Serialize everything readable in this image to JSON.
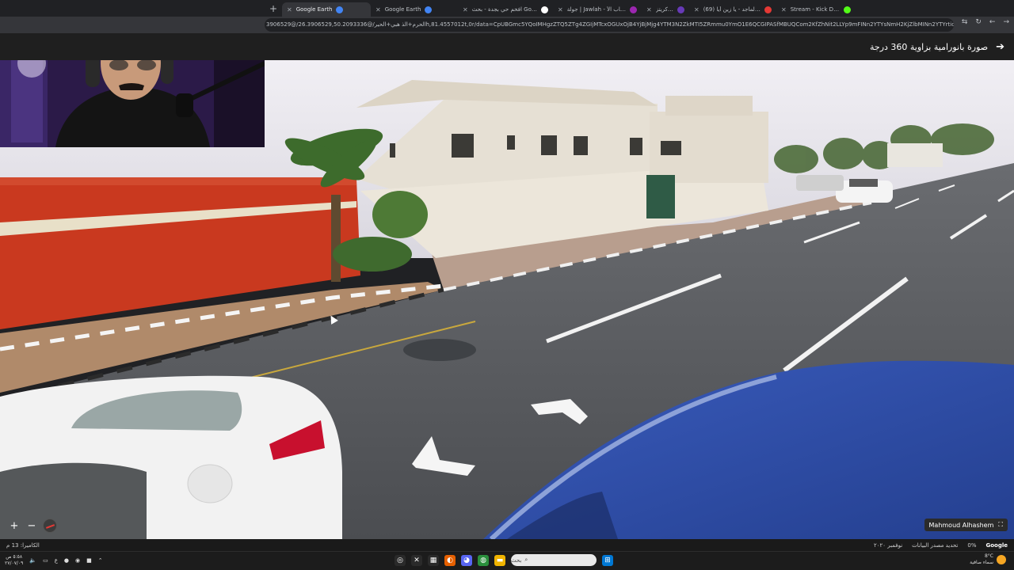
{
  "browser": {
    "tabs": [
      {
        "label": "Google Earth",
        "active": true,
        "fav_color": "#4285f4"
      },
      {
        "label": "Google Earth",
        "active": false,
        "fav_color": "#4285f4"
      },
      {
        "label": "افخم حي بجدة - بحث Google",
        "active": false,
        "fav_color": "#ffffff"
      },
      {
        "label": "جولة | Jawlah - منصة الألعاب الأ...",
        "active": false,
        "fav_color": "#9c27b0"
      },
      {
        "label": "المحفظة | كريتز",
        "active": false,
        "fav_color": "#673ab7"
      },
      {
        "label": "(69) راشد الماجد - يا زين أيا...",
        "active": false,
        "fav_color": "#e53935"
      },
      {
        "label": "Stream - Kick Dashboard",
        "active": false,
        "fav_color": "#53fc18"
      }
    ],
    "new_tab": "+",
    "url": "3906529@/الحرم+الذ هبي+الحير/@26.3906529,50.2093336h,81.4557012t,0r/data=CpUBGmc5YQoIMHgzZTQ5ZTg4ZGIjMTcxOGUxOjB4YjBjMjg4YTM3N2ZkMTI5ZRmmu0YmO1E6QCGIPASfMBUQCom2KfZhNit2LLYp9mFINn2YTYsNmH2KjZlbMINn2YTYrtio2LEYASABIiYKJAmYWDwGNMU...",
    "nav": [
      "⇆",
      "↻",
      "←",
      "→"
    ]
  },
  "streetview": {
    "title": "صورة بانورامية بزاوية 360 درجة",
    "back_icon": "arrow-right-icon"
  },
  "controls": {
    "zoom_in": "+",
    "zoom_out": "−",
    "attribution": "Mahmoud Alhashem"
  },
  "status": {
    "left": "الكاميرا: 13 م",
    "right_items": [
      "نوفمبر ٢٠٢٠",
      "تحديد مصدر البيانات",
      "0%"
    ],
    "brand": "Google"
  },
  "taskbar": {
    "clock_time": "٥:٥٨ ص",
    "clock_date": "٢٧/٠٧/٠٩",
    "lang": "ع",
    "search_placeholder": "بحث",
    "weather_temp": "8°C",
    "weather_desc": "سماء صافية"
  },
  "colors": {
    "sky": "#e4e2ea",
    "road": "#5b5e63",
    "red_wall": "#c9391f",
    "villa": "#e6e0d4",
    "blue_car": "#2f4fa8",
    "white_car": "#f2f2f2"
  }
}
